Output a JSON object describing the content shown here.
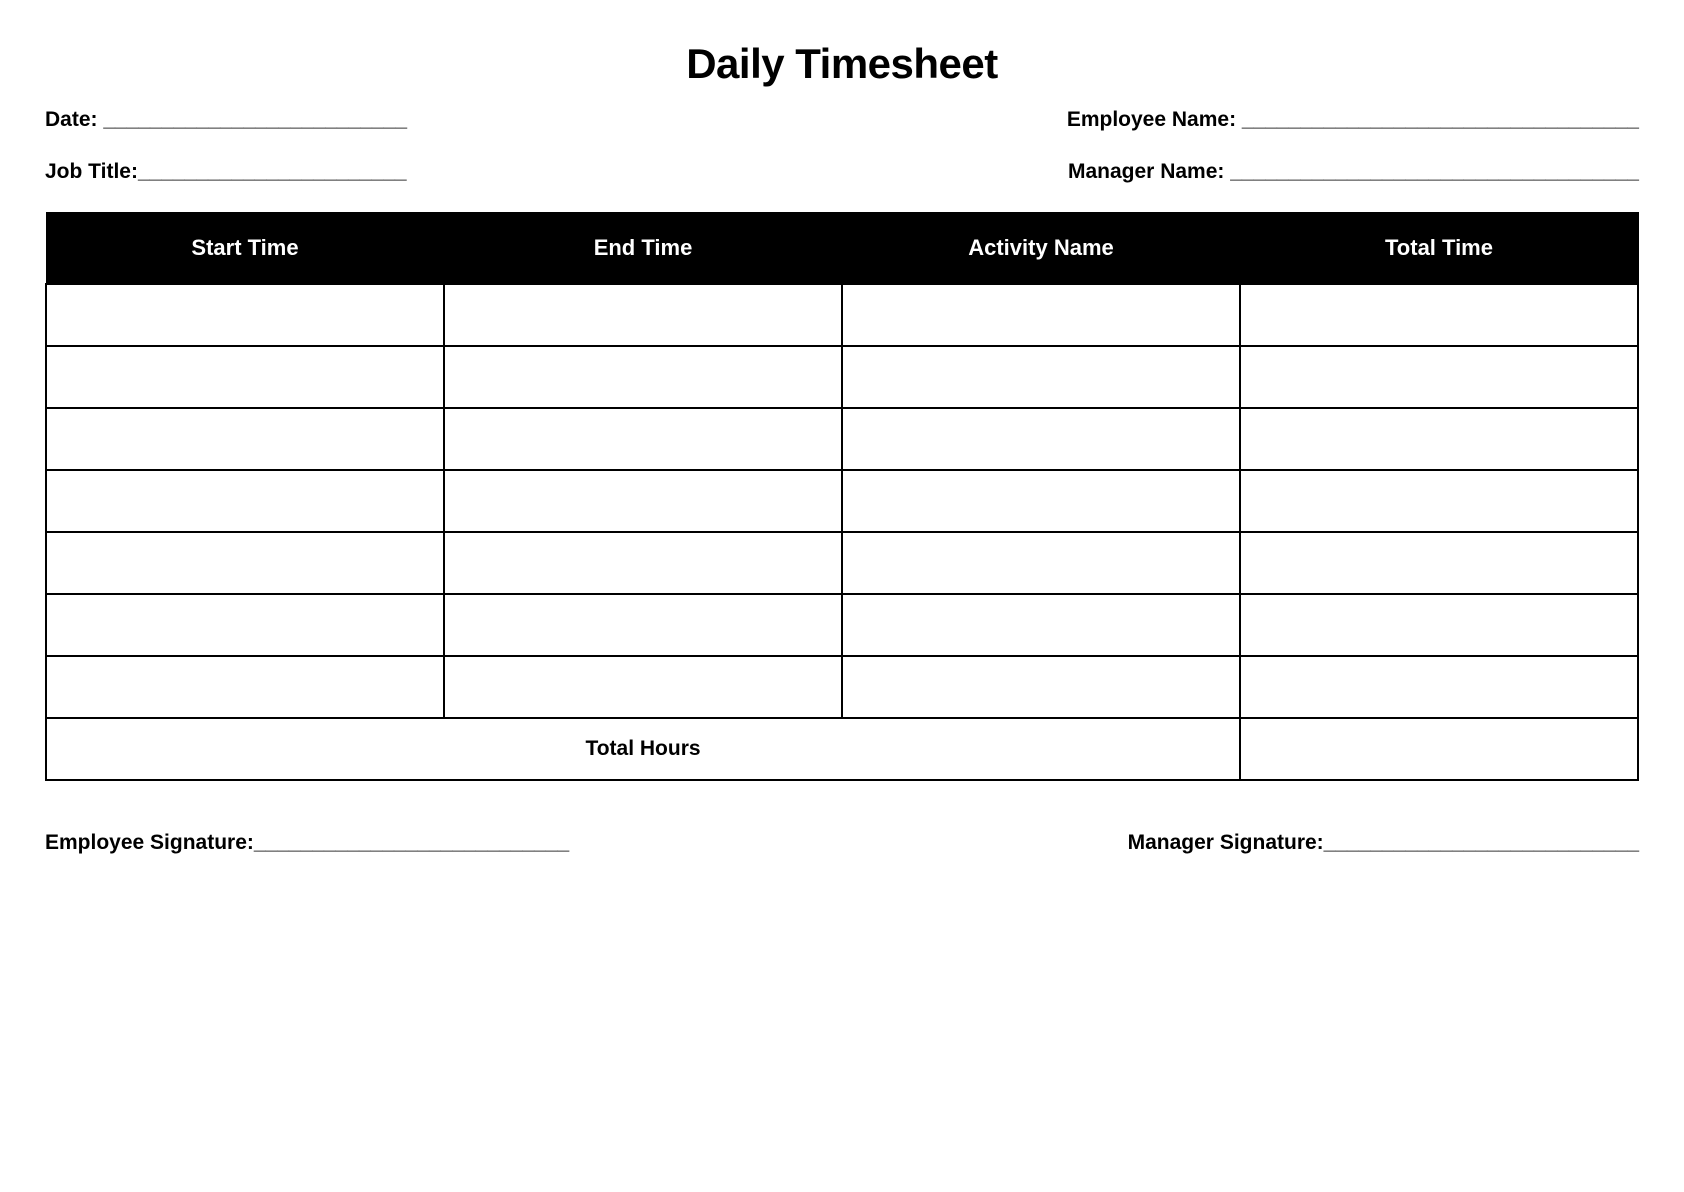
{
  "title": "Daily Timesheet",
  "fields": {
    "date": "Date: __________________________",
    "employee_name": "Employee Name: __________________________________",
    "job_title": "Job Title:_______________________",
    "manager_name": "Manager Name: ___________________________________"
  },
  "table": {
    "headers": {
      "start_time": "Start Time",
      "end_time": "End Time",
      "activity_name": "Activity Name",
      "total_time": "Total Time"
    },
    "total_hours_label": "Total Hours"
  },
  "signatures": {
    "employee": "Employee Signature:___________________________",
    "manager": "Manager Signature:___________________________"
  }
}
